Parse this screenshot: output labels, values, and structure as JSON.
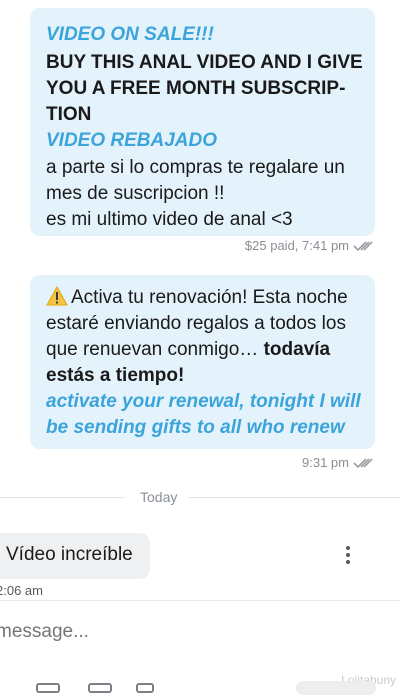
{
  "messages": [
    {
      "direction": "outgoing",
      "lines": {
        "l1": "VIDEO ON SALE!!!",
        "l2": "BUY THIS ANAL VIDEO AND I GIVE",
        "l3": "YOU A FREE MONTH SUBSCRIP-",
        "l4": "TION",
        "l5": "VIDEO REBAJADO",
        "l6": "a parte si lo compras te regalare un",
        "l7": "mes de suscripcion !!",
        "l8": "es mi ultimo video de anal <3"
      },
      "meta": "$25 paid, 7:41 pm"
    },
    {
      "direction": "outgoing",
      "lines": {
        "l1": "Activa tu renovación! Esta noche",
        "l2": "estaré enviando regalos a todos los",
        "l3a": "que renuevan conmigo… ",
        "l3b": "todavía",
        "l4": "estás a tiempo!",
        "l5": "activate your renewal, tonight I will",
        "l6": "be sending gifts to all who renew"
      },
      "meta": "9:31 pm"
    },
    {
      "direction": "incoming",
      "text": "Vídeo increíble",
      "time": "2:06 am"
    }
  ],
  "divider_label": "Today",
  "composer": {
    "placeholder": "message..."
  },
  "watermark": "Lolitabuny",
  "colors": {
    "outgoing_bubble": "#e4f2fb",
    "accent": "#3ba5db",
    "incoming_bubble": "#eef0f2"
  },
  "icons": [
    "warning-icon",
    "double-check-icon",
    "more-vertical-icon"
  ]
}
